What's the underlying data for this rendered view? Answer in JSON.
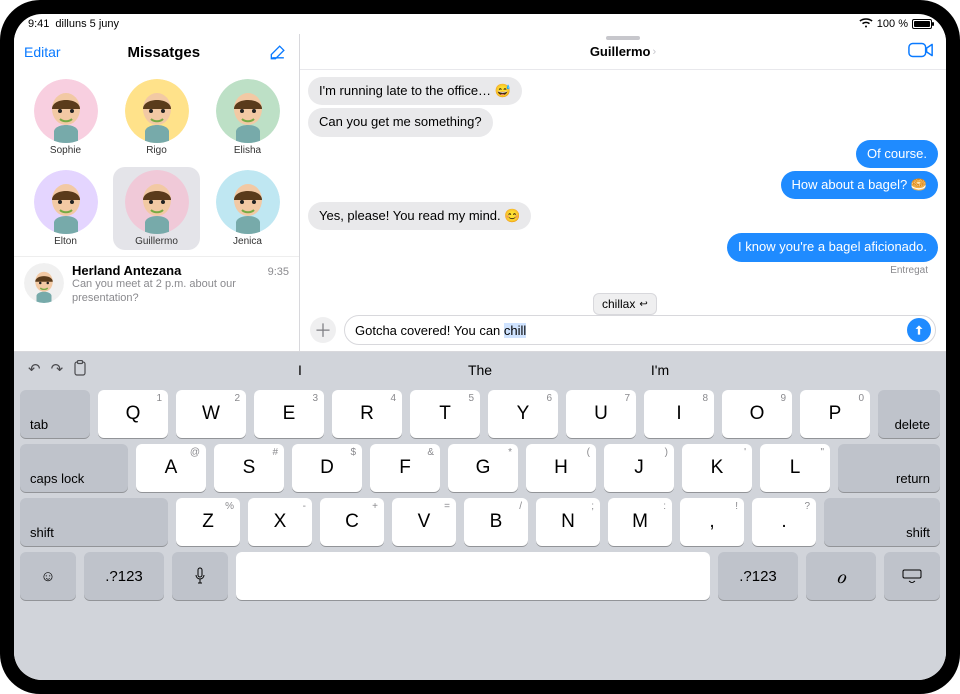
{
  "status": {
    "time": "9:41",
    "date": "dilluns 5 juny",
    "battery": "100 %",
    "wifi": "wifi"
  },
  "sidebar": {
    "edit": "Editar",
    "title": "Missatges",
    "pinned": [
      {
        "name": "Sophie",
        "bg": "#f8cfe0"
      },
      {
        "name": "Rigo",
        "bg": "#ffe28a"
      },
      {
        "name": "Elisha",
        "bg": "#bde0c6"
      },
      {
        "name": "Elton",
        "bg": "#e4d5ff"
      },
      {
        "name": "Guillermo",
        "bg": "#f0c9d8",
        "selected": true
      },
      {
        "name": "Jenica",
        "bg": "#bfe7f2"
      }
    ],
    "conversations": [
      {
        "name": "Herland Antezana",
        "time": "9:35",
        "preview": "Can you meet at 2 p.m. about our presentation?",
        "bg": "#f0f0f0"
      }
    ]
  },
  "chat": {
    "name": "Guillermo",
    "facetime_icon": "facetime",
    "messages": [
      {
        "dir": "in",
        "text": "I'm running late to the office… 😅"
      },
      {
        "dir": "in",
        "text": "Can you get me something?"
      },
      {
        "dir": "out",
        "text": "Of course."
      },
      {
        "dir": "out",
        "text": "How about a bagel? 🥯"
      },
      {
        "dir": "in",
        "text": "Yes, please! You read my mind. 😊"
      },
      {
        "dir": "out",
        "text": "I know you're a bagel aficionado."
      }
    ],
    "delivered": "Entregat",
    "suggestion": "chillax",
    "input_prefix": "Gotcha covered! You can ",
    "input_selected": "chill"
  },
  "keyboard": {
    "suggestions": [
      "I",
      "The",
      "I'm"
    ],
    "rows": {
      "r1": [
        {
          "k": "Q",
          "h": "1"
        },
        {
          "k": "W",
          "h": "2"
        },
        {
          "k": "E",
          "h": "3"
        },
        {
          "k": "R",
          "h": "4"
        },
        {
          "k": "T",
          "h": "5"
        },
        {
          "k": "Y",
          "h": "6"
        },
        {
          "k": "U",
          "h": "7"
        },
        {
          "k": "I",
          "h": "8"
        },
        {
          "k": "O",
          "h": "9"
        },
        {
          "k": "P",
          "h": "0"
        }
      ],
      "r2": [
        {
          "k": "A",
          "h": "@"
        },
        {
          "k": "S",
          "h": "#"
        },
        {
          "k": "D",
          "h": "$"
        },
        {
          "k": "F",
          "h": "&"
        },
        {
          "k": "G",
          "h": "*"
        },
        {
          "k": "H",
          "h": "("
        },
        {
          "k": "J",
          "h": ")"
        },
        {
          "k": "K",
          "h": "'"
        },
        {
          "k": "L",
          "h": "\""
        }
      ],
      "r3": [
        {
          "k": "Z",
          "h": "%"
        },
        {
          "k": "X",
          "h": "-"
        },
        {
          "k": "C",
          "h": "+"
        },
        {
          "k": "V",
          "h": "="
        },
        {
          "k": "B",
          "h": "/"
        },
        {
          "k": "N",
          "h": ";"
        },
        {
          "k": "M",
          "h": ":"
        },
        {
          "k": ",",
          "h": "!"
        },
        {
          "k": ".",
          "h": "?"
        }
      ]
    },
    "mods": {
      "tab": "tab",
      "delete": "delete",
      "caps": "caps lock",
      "return": "return",
      "shift_l": "shift",
      "shift_r": "shift",
      "numsym_l": ".?123",
      "numsym_r": ".?123"
    }
  }
}
